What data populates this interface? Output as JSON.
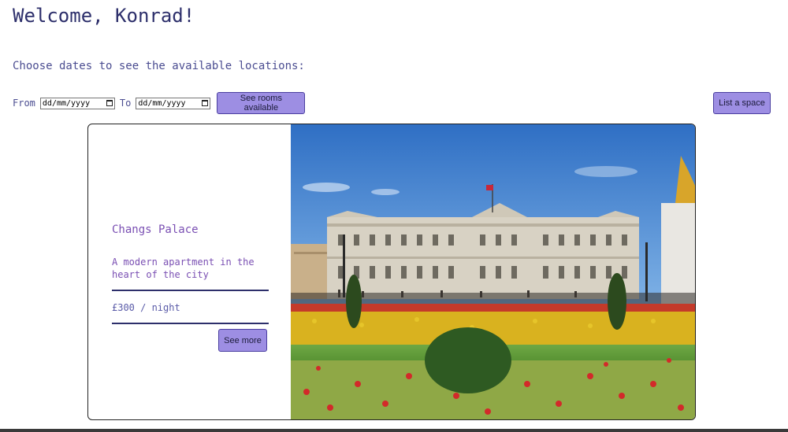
{
  "header": {
    "welcome": "Welcome, Konrad!",
    "subtitle": "Choose dates to see the available locations:"
  },
  "search": {
    "from_label": "From",
    "from_placeholder": "dd/mm/yyyy",
    "to_label": "To",
    "to_placeholder": "dd/mm/yyyy",
    "rooms_button": "See rooms available"
  },
  "actions": {
    "list_space_button": "List a space"
  },
  "listing": {
    "name": "Changs Palace",
    "description": "A modern apartment in the heart of the city",
    "price": "£300 / night",
    "more_button": "See more",
    "photo_icon": "palace-photo"
  },
  "colors": {
    "accent": "#9d8ee3",
    "accent_border": "#4a3fa0",
    "heading": "#2d2f6b",
    "listing_text": "#7a4fb3"
  }
}
